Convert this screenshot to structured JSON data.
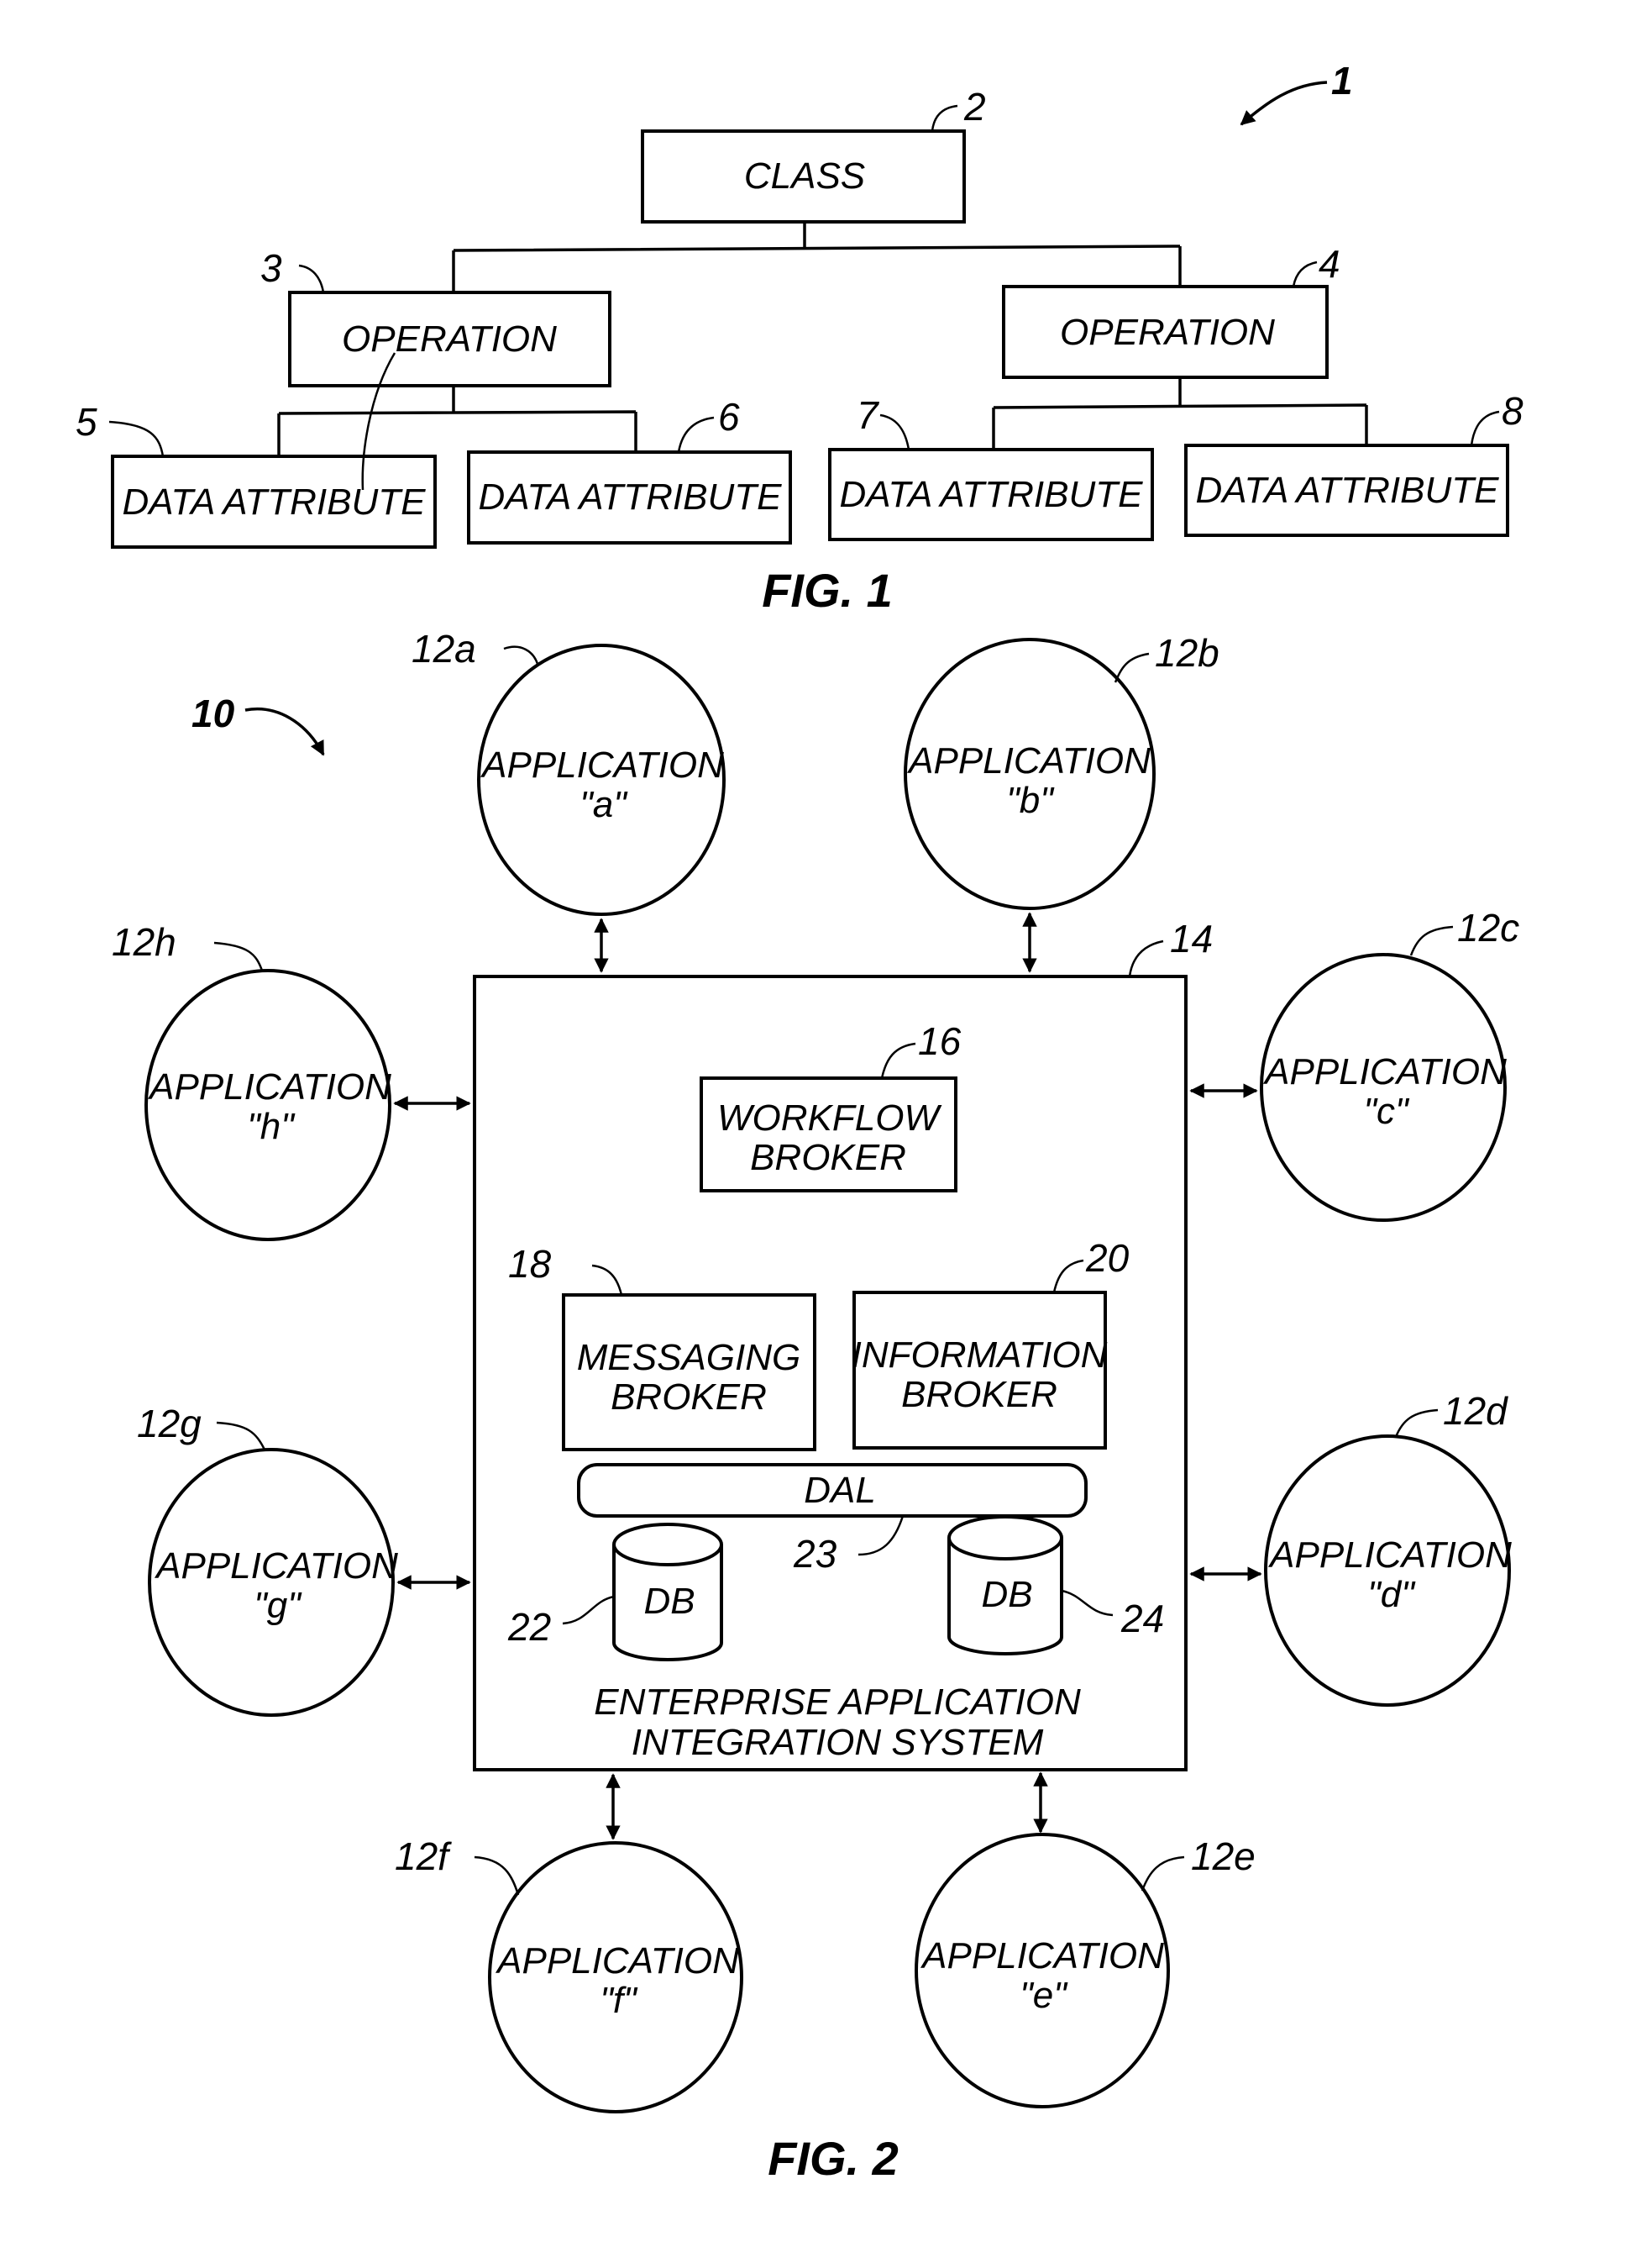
{
  "figure1": {
    "ref": "1",
    "caption": "FIG. 1",
    "class_node": {
      "ref": "2",
      "label": "CLASS"
    },
    "operations": [
      {
        "ref": "3",
        "label": "OPERATION"
      },
      {
        "ref": "4",
        "label": "OPERATION"
      }
    ],
    "attributes": [
      {
        "ref": "5",
        "label": "DATA ATTRIBUTE"
      },
      {
        "ref": "6",
        "label": "DATA ATTRIBUTE"
      },
      {
        "ref": "7",
        "label": "DATA ATTRIBUTE"
      },
      {
        "ref": "8",
        "label": "DATA ATTRIBUTE"
      }
    ]
  },
  "figure2": {
    "ref": "10",
    "caption": "FIG. 2",
    "system": {
      "ref": "14",
      "label_line1": "ENTERPRISE APPLICATION",
      "label_line2": "INTEGRATION SYSTEM"
    },
    "workflow_broker": {
      "ref": "16",
      "line1": "WORKFLOW",
      "line2": "BROKER"
    },
    "messaging_broker": {
      "ref": "18",
      "line1": "MESSAGING",
      "line2": "BROKER"
    },
    "information_broker": {
      "ref": "20",
      "line1": "INFORMATION",
      "line2": "BROKER"
    },
    "dal": {
      "ref": "23",
      "label": "DAL"
    },
    "databases": [
      {
        "ref": "22",
        "label": "DB"
      },
      {
        "ref": "24",
        "label": "DB"
      }
    ],
    "applications": [
      {
        "ref": "12a",
        "line1": "APPLICATION",
        "line2": "\"a\""
      },
      {
        "ref": "12b",
        "line1": "APPLICATION",
        "line2": "\"b\""
      },
      {
        "ref": "12c",
        "line1": "APPLICATION",
        "line2": "\"c\""
      },
      {
        "ref": "12d",
        "line1": "APPLICATION",
        "line2": "\"d\""
      },
      {
        "ref": "12e",
        "line1": "APPLICATION",
        "line2": "\"e\""
      },
      {
        "ref": "12f",
        "line1": "APPLICATION",
        "line2": "\"f\""
      },
      {
        "ref": "12g",
        "line1": "APPLICATION",
        "line2": "\"g\""
      },
      {
        "ref": "12h",
        "line1": "APPLICATION",
        "line2": "\"h\""
      }
    ]
  }
}
